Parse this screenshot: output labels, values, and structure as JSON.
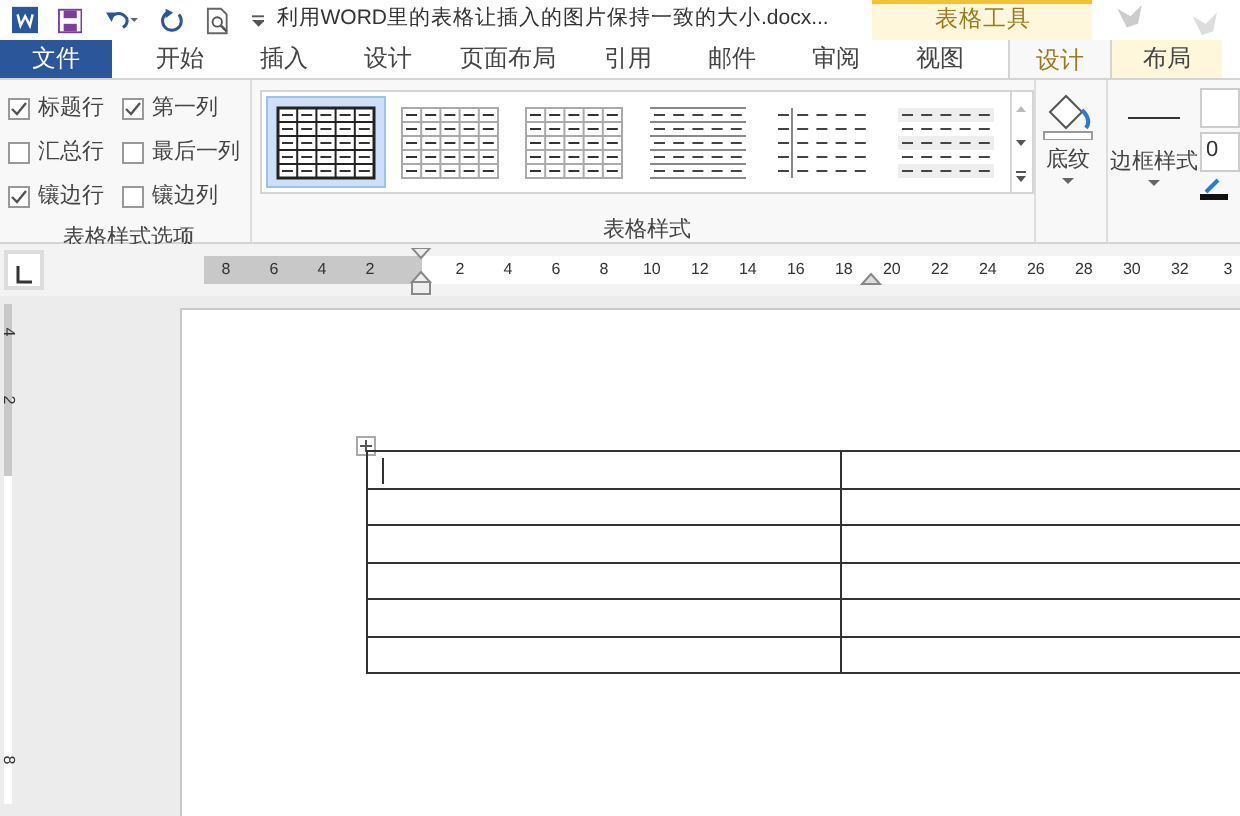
{
  "title_bar": {
    "title": "利用WORD里的表格让插入的图片保持一致的大小.docx...",
    "contextual_group": "表格工具"
  },
  "tabs": [
    {
      "label": "文件",
      "kind": "file",
      "selected": false
    },
    {
      "label": "开始",
      "kind": "normal",
      "selected": false
    },
    {
      "label": "插入",
      "kind": "normal",
      "selected": false
    },
    {
      "label": "设计",
      "kind": "normal",
      "selected": false
    },
    {
      "label": "页面布局",
      "kind": "normal",
      "selected": false
    },
    {
      "label": "引用",
      "kind": "normal",
      "selected": false
    },
    {
      "label": "邮件",
      "kind": "normal",
      "selected": false
    },
    {
      "label": "审阅",
      "kind": "normal",
      "selected": false
    },
    {
      "label": "视图",
      "kind": "normal",
      "selected": false
    },
    {
      "label": "设计",
      "kind": "contextual",
      "selected": true
    },
    {
      "label": "布局",
      "kind": "contextual",
      "selected": false
    }
  ],
  "style_options": {
    "group_label": "表格样式选项",
    "items": [
      {
        "label": "标题行",
        "checked": true
      },
      {
        "label": "第一列",
        "checked": true
      },
      {
        "label": "汇总行",
        "checked": false
      },
      {
        "label": "最后一列",
        "checked": false
      },
      {
        "label": "镶边行",
        "checked": true
      },
      {
        "label": "镶边列",
        "checked": false
      }
    ]
  },
  "table_styles": {
    "group_label": "表格样式",
    "styles": [
      {
        "kind": "grid-bold",
        "selected": true
      },
      {
        "kind": "grid-light",
        "selected": false
      },
      {
        "kind": "grid-light",
        "selected": false
      },
      {
        "kind": "horizontal",
        "selected": false
      },
      {
        "kind": "first-column",
        "selected": false
      },
      {
        "kind": "banded",
        "selected": false
      }
    ]
  },
  "shading_button": {
    "label": "底纹"
  },
  "border_styles_button": {
    "label": "边框样式"
  },
  "pen_weight_field": {
    "value": "0"
  },
  "horizontal_ruler": {
    "left_labels": [
      "8",
      "6",
      "4",
      "2"
    ],
    "labels": [
      "2",
      "4",
      "6",
      "8",
      "10",
      "12",
      "14",
      "16",
      "18",
      "20",
      "22",
      "24",
      "26",
      "28",
      "30",
      "32",
      "3"
    ]
  },
  "vertical_ruler": {
    "labels": [
      "4",
      "2",
      "8"
    ]
  }
}
